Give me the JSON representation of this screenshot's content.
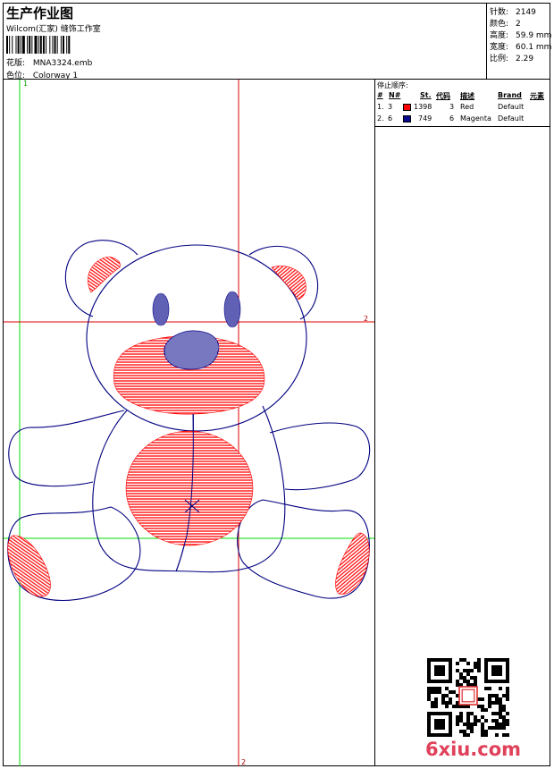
{
  "header": {
    "title": "生产作业图",
    "company": "Wilcom(汇家) 缝饰工作室",
    "design_label": "花版:",
    "design_value": "MNA3324.emb",
    "colorway_label": "色位:",
    "colorway_value": "Colorway 1"
  },
  "stats": [
    {
      "label": "针数:",
      "value": "2149"
    },
    {
      "label": "颜色:",
      "value": "2"
    },
    {
      "label": "高度:",
      "value": "59.9 mm"
    },
    {
      "label": "宽度:",
      "value": "60.1 mm"
    },
    {
      "label": "比例:",
      "value": "2.29"
    }
  ],
  "stop_sequence": {
    "title": "停止顺序:",
    "columns": [
      "#",
      "N#",
      "St.",
      "代码",
      "描述",
      "Brand",
      "元素"
    ],
    "rows": [
      {
        "index": "1.",
        "n": "3",
        "color": "#ff0000",
        "stitches": "1398",
        "code": "3",
        "desc": "Red",
        "brand": "Default"
      },
      {
        "index": "2.",
        "n": "6",
        "color": "#0a0a8c",
        "stitches": "749",
        "code": "6",
        "desc": "Magenta",
        "brand": "Default"
      }
    ]
  },
  "guides": {
    "top_marker": "1",
    "right_marker": "2",
    "bottom_marker": "2"
  },
  "colors": {
    "outline": "#000080",
    "fill_red": "#ff0000",
    "fill_blue": "#0a0a8c",
    "guide_red": "#e00000",
    "guide_green": "#00e000"
  },
  "watermark": "6xiu.com"
}
